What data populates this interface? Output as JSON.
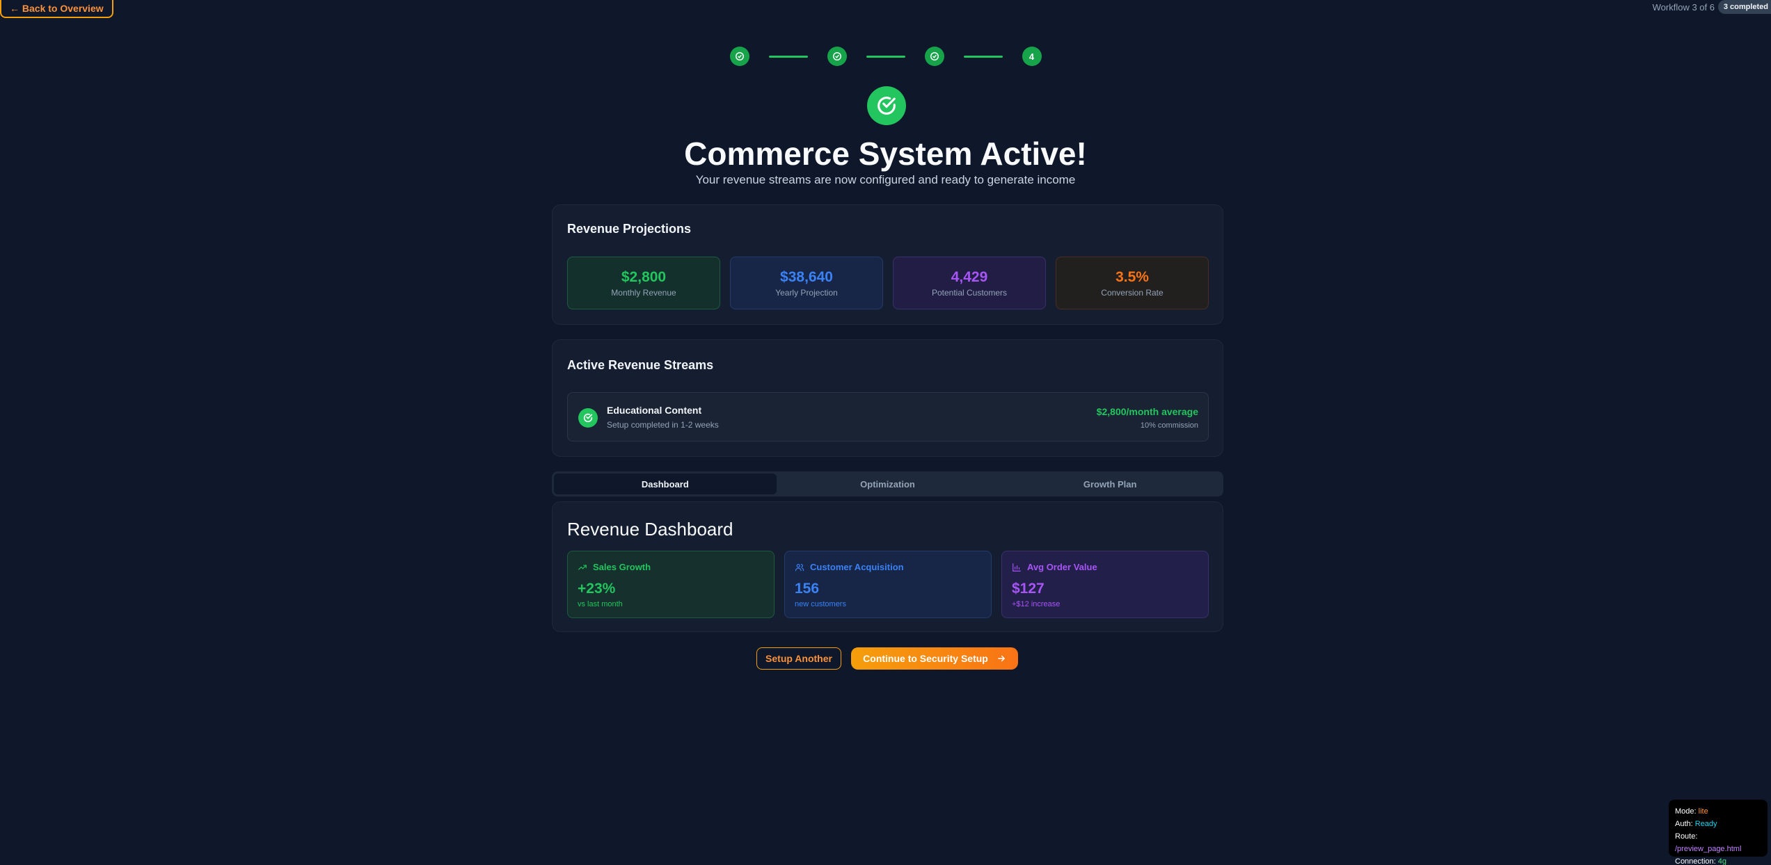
{
  "nav": {
    "back_label": "← Back to Overview",
    "workflow_label": "Workflow 3 of 6",
    "completed_badge": "3 completed"
  },
  "stepper": {
    "steps": [
      {
        "state": "done"
      },
      {
        "state": "done"
      },
      {
        "state": "done"
      },
      {
        "state": "current",
        "label": "4"
      }
    ]
  },
  "hero": {
    "title": "Commerce System Active!",
    "subtitle": "Your revenue streams are now configured and ready to generate income"
  },
  "projections": {
    "title": "Revenue Projections",
    "metrics": [
      {
        "value": "$2,800",
        "label": "Monthly Revenue"
      },
      {
        "value": "$38,640",
        "label": "Yearly Projection"
      },
      {
        "value": "4,429",
        "label": "Potential Customers"
      },
      {
        "value": "3.5%",
        "label": "Conversion Rate"
      }
    ]
  },
  "streams": {
    "title": "Active Revenue Streams",
    "items": [
      {
        "name": "Educational Content",
        "setup": "Setup completed in 1-2 weeks",
        "amount": "$2,800/month average",
        "commission": "10% commission"
      }
    ]
  },
  "tabs": [
    {
      "label": "Dashboard",
      "active": true
    },
    {
      "label": "Optimization",
      "active": false
    },
    {
      "label": "Growth Plan",
      "active": false
    }
  ],
  "dashboard": {
    "title": "Revenue Dashboard",
    "cards": [
      {
        "icon": "trending-up-icon",
        "heading": "Sales Growth",
        "value": "+23%",
        "sub": "vs last month"
      },
      {
        "icon": "users-icon",
        "heading": "Customer Acquisition",
        "value": "156",
        "sub": "new customers"
      },
      {
        "icon": "bar-chart-icon",
        "heading": "Avg Order Value",
        "value": "$127",
        "sub": "+$12 increase"
      }
    ]
  },
  "actions": {
    "secondary": "Setup Another",
    "primary": "Continue to Security Setup"
  },
  "debug": {
    "mode_label": "Mode:",
    "mode_value": "lite",
    "auth_label": "Auth:",
    "auth_value": "Ready",
    "route_label": "Route:",
    "route_value": "/preview_page.html",
    "conn_label": "Connection:",
    "conn_value": "4g"
  },
  "colors": {
    "background": "#0f172a",
    "success": "#22c55e",
    "accent": "#f97316",
    "blue": "#3b82f6",
    "purple": "#a855f7"
  }
}
